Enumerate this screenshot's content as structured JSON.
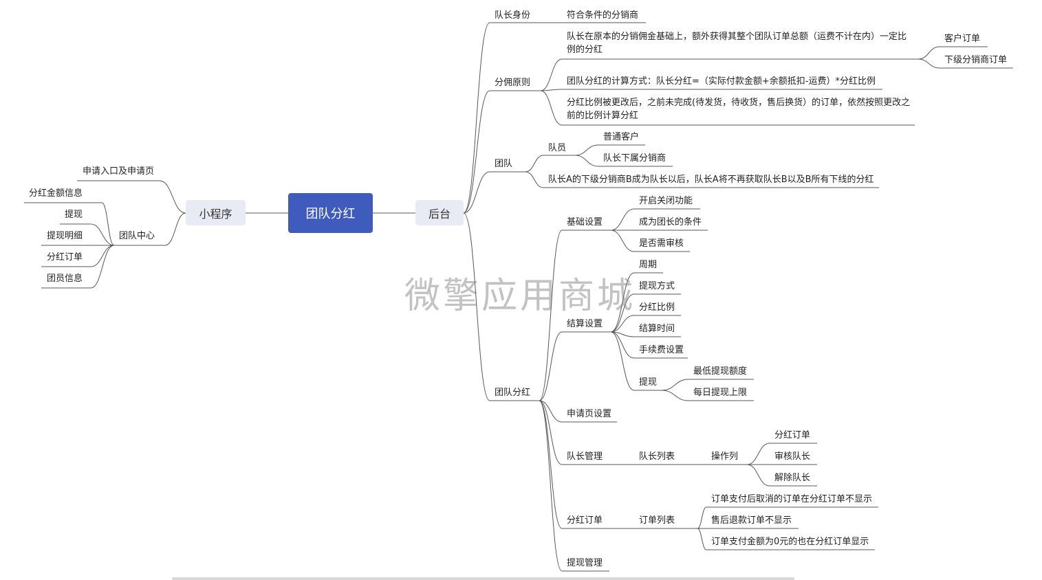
{
  "root": "团队分红",
  "left_main": "小程序",
  "right_main": "后台",
  "watermark": "微擎应用商城",
  "miniprogram": {
    "apply": "申请入口及申请页",
    "center": "团队中心",
    "center_items": [
      "分红金额信息",
      "提现",
      "提现明细",
      "分红订单",
      "团员信息"
    ]
  },
  "backend": {
    "captain_identity": {
      "label": "队长身份",
      "child": "符合条件的分销商"
    },
    "commission": {
      "label": "分佣原则",
      "rule1": "队长在原本的分销佣金基础上，额外获得其整个团队订单总额（运费不计在内）一定比例的分红",
      "rule1_children": [
        "客户订单",
        "下级分销商订单"
      ],
      "rule2": "团队分红的计算方式：队长分红=（实际付款金额+余额抵扣-运费）*分红比例",
      "rule3": "分红比例被更改后，之前未完成(待发货，待收货，售后换货）的订单，依然按照更改之前的比例计算分红"
    },
    "team": {
      "label": "团队",
      "members": "队员",
      "member_items": [
        "普通客户",
        "队长下属分销商"
      ],
      "rule": "队长A的下级分销商B成为队长以后，队长A将不再获取队长B以及B所有下线的分红"
    },
    "dividend": {
      "label": "团队分红",
      "basic": {
        "label": "基础设置",
        "items": [
          "开启关闭功能",
          "成为团长的条件",
          "是否需审核"
        ]
      },
      "settle": {
        "label": "结算设置",
        "items": [
          "周期",
          "提现方式",
          "分红比例",
          "结算时间",
          "手续费设置"
        ],
        "withdraw": {
          "label": "提现",
          "items": [
            "最低提现额度",
            "每日提现上限"
          ]
        }
      },
      "apply_page": "申请页设置",
      "captain_mgmt": {
        "label": "队长管理",
        "list": "队长列表",
        "ops": "操作列",
        "op_items": [
          "分红订单",
          "审核队长",
          "解除队长"
        ]
      },
      "orders": {
        "label": "分红订单",
        "list": "订单列表",
        "items": [
          "订单支付后取消的订单在分红订单不显示",
          "售后退款订单不显示",
          "订单支付金额为0元的也在分红订单显示"
        ]
      },
      "withdraw_mgmt": "提现管理"
    }
  },
  "colors": {
    "root_bg": "#3f5bbd",
    "main_bg": "#e9ebf4",
    "line": "#555555"
  }
}
